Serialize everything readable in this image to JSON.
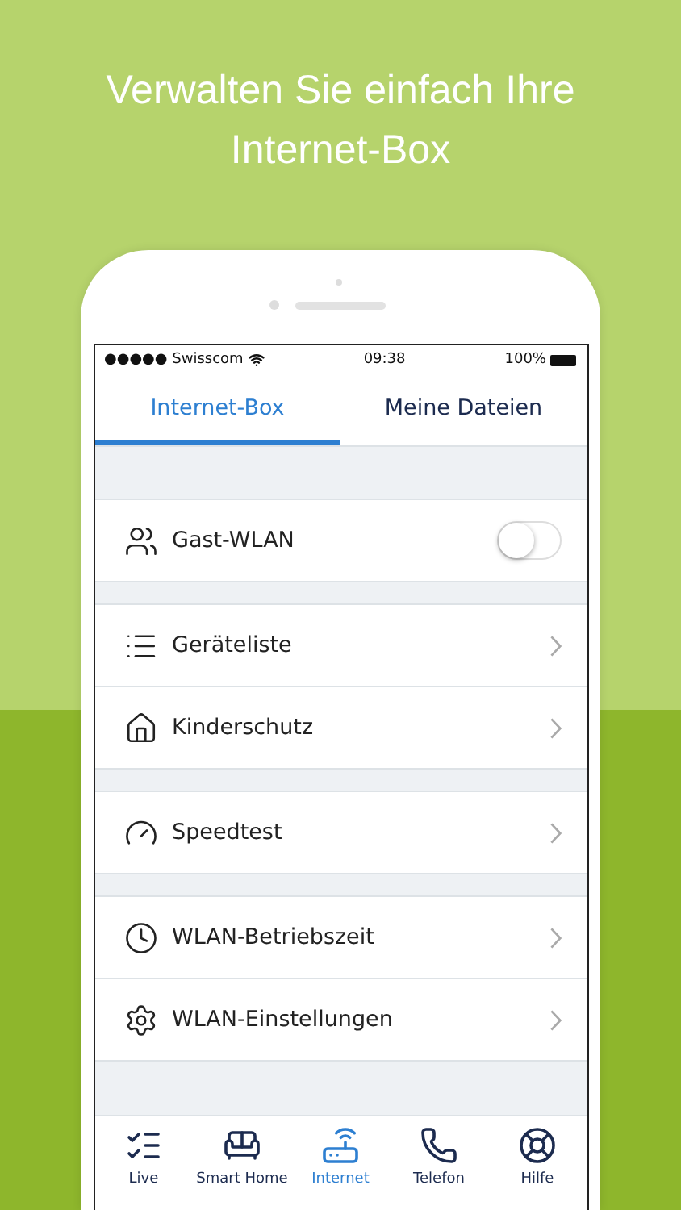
{
  "headline": [
    "Verwalten Sie einfach Ihre",
    "Internet-Box"
  ],
  "status_bar": {
    "carrier": "●●●●● Swisscom",
    "time": "09:38",
    "battery": "100%"
  },
  "tabs": [
    {
      "label": "Internet-Box",
      "selected": true
    },
    {
      "label": "Meine Dateien",
      "selected": false
    }
  ],
  "sections": [
    {
      "rows": [
        {
          "kind": "toggle",
          "label": "Gast-WLAN",
          "on": false
        }
      ]
    },
    {
      "rows": [
        {
          "kind": "link",
          "label": "Geräteliste"
        },
        {
          "kind": "link",
          "label": "Kinderschutz"
        }
      ]
    },
    {
      "rows": [
        {
          "kind": "link",
          "label": "Speedtest"
        }
      ]
    },
    {
      "rows": [
        {
          "kind": "link",
          "label": "WLAN-Betriebszeit"
        },
        {
          "kind": "link",
          "label": "WLAN-Einstellungen"
        }
      ]
    }
  ],
  "bottom_nav": [
    {
      "label": "Live",
      "selected": false
    },
    {
      "label": "Smart Home",
      "selected": false
    },
    {
      "label": "Internet",
      "selected": true
    },
    {
      "label": "Telefon",
      "selected": false
    },
    {
      "label": "Hilfe",
      "selected": false
    }
  ]
}
